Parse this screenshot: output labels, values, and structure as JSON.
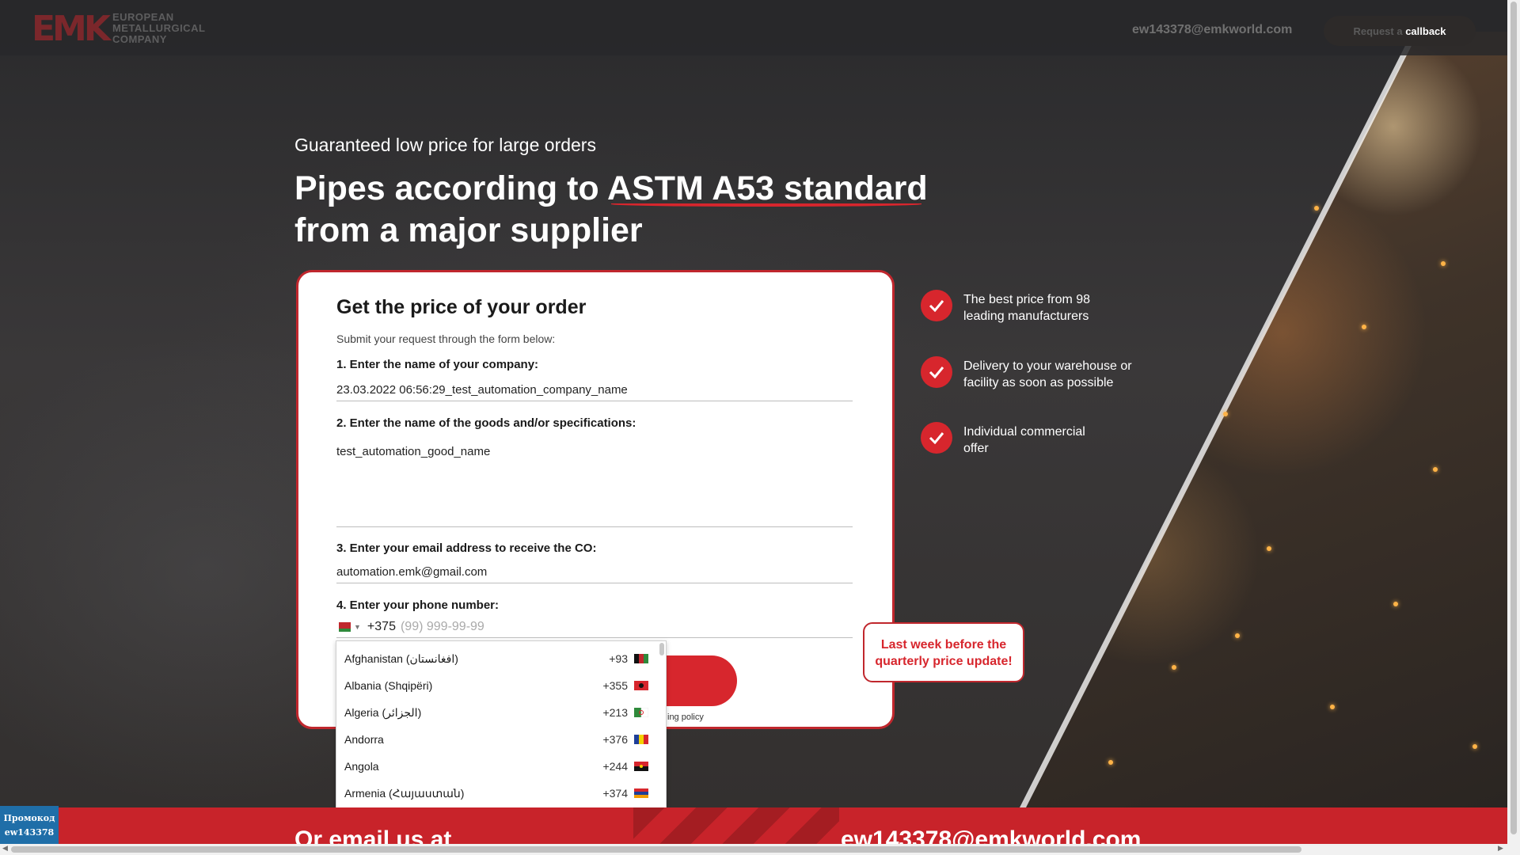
{
  "header": {
    "logo_mark": "EMK",
    "logo_line1": "EUROPEAN",
    "logo_line2": "METALLURGICAL",
    "logo_line3": "COMPANY",
    "email": "ew143378@emkworld.com",
    "callback_prefix": "Request a ",
    "callback_highlight": "callback"
  },
  "hero": {
    "subtitle": "Guaranteed low price for large orders",
    "title_line1": "Pipes according to ASTM A53 standard",
    "title_line2": "from a major supplier"
  },
  "form": {
    "title": "Get the price of your order",
    "description": "Submit your request through the form below:",
    "company_label": "1. Enter the name of your company:",
    "company_value": "23.03.2022 06:56:29_test_automation_company_name",
    "goods_label": "2. Enter the name of the goods and/or specifications:",
    "goods_value": "test_automation_good_name",
    "email_label": "3. Enter your email address to receive the CO:",
    "email_value": "automation.emk@gmail.com",
    "phone_label": "4. Enter your phone number:",
    "phone_dial_code": "+375",
    "phone_placeholder": "(99) 999-99-99",
    "policy_text": "ing policy"
  },
  "country_dropdown": [
    {
      "name": "Afghanistan (‫افغانستان‬‎)",
      "code": "+93",
      "flag": "af"
    },
    {
      "name": "Albania (Shqipëri)",
      "code": "+355",
      "flag": "al"
    },
    {
      "name": "Algeria (‫الجزائر‬‎)",
      "code": "+213",
      "flag": "dz"
    },
    {
      "name": "Andorra",
      "code": "+376",
      "flag": "ad"
    },
    {
      "name": "Angola",
      "code": "+244",
      "flag": "ao"
    },
    {
      "name": "Armenia (Հայաստան)",
      "code": "+374",
      "flag": "am"
    }
  ],
  "promo_box": {
    "line1": "Last week before the",
    "line2": "quarterly price update!"
  },
  "benefits": [
    {
      "line1": "The best price from 98",
      "line2": "leading manufacturers"
    },
    {
      "line1": "Delivery to your warehouse or",
      "line2": "facility as soon as possible"
    },
    {
      "line1": "Individual commercial",
      "line2": "offer"
    }
  ],
  "bottom_band": {
    "left_text": "Or email us at",
    "right_text": "ew143378@emkworld.com"
  },
  "promo_badge": {
    "line1": "Промокод",
    "line2": "ew143378"
  },
  "colors": {
    "accent": "#d7262d",
    "dark": "#2b2827"
  }
}
